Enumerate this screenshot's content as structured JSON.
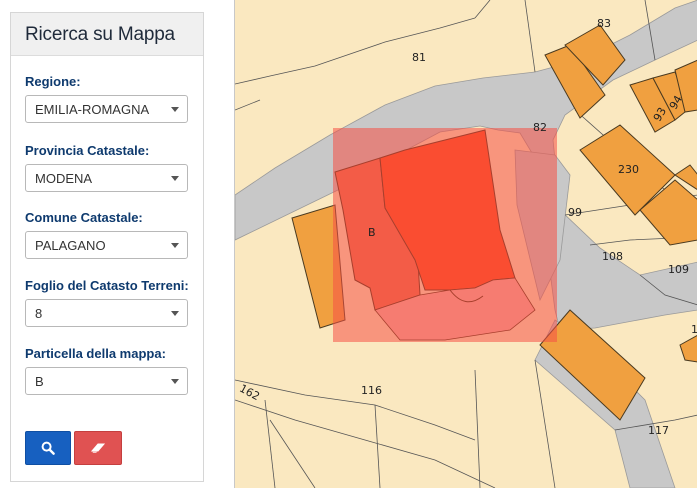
{
  "search_panel": {
    "title": "Ricerca su Mappa",
    "fields": [
      {
        "label": "Regione:",
        "value": "EMILIA-ROMAGNA"
      },
      {
        "label": "Provincia Catastale:",
        "value": "MODENA"
      },
      {
        "label": "Comune Catastale:",
        "value": "PALAGANO"
      },
      {
        "label": "Foglio del Catasto Terreni:",
        "value": "8"
      },
      {
        "label": "Particella della mappa:",
        "value": "B"
      }
    ],
    "search_icon": "search-icon",
    "clear_icon": "eraser-icon",
    "search_button_color": "#1760c0",
    "clear_button_color": "#e05252"
  },
  "map": {
    "parcel_labels": [
      "83",
      "81",
      "94",
      "82",
      "93",
      "230",
      "B",
      "99",
      "108",
      "109",
      "162",
      "116",
      "117",
      "1"
    ],
    "colors": {
      "land": "#fae8c0",
      "road": "#c8c8c8",
      "building": "#f0a040",
      "selected_parcel": "#ff4a1a",
      "selection_box": "rgba(245, 80, 70, 0.55)"
    }
  }
}
